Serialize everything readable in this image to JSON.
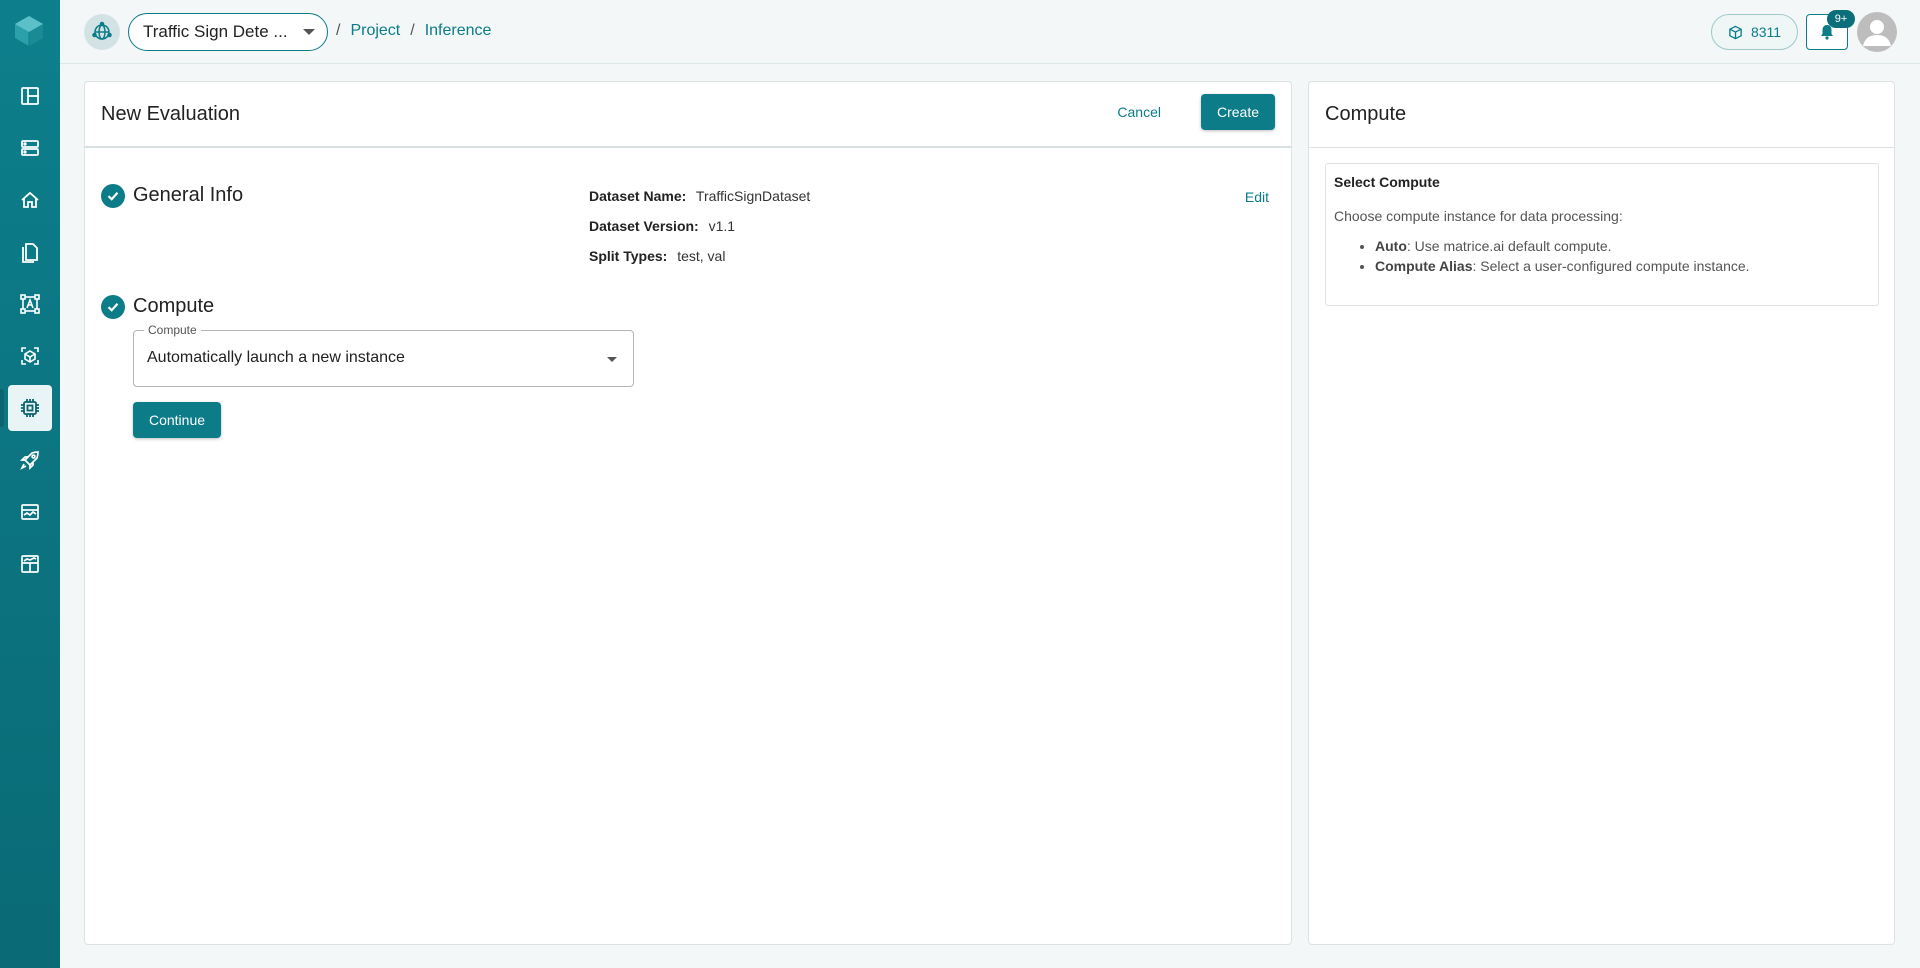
{
  "sidebar": {
    "items": [
      {
        "icon": "layout-icon"
      },
      {
        "icon": "server-icon"
      },
      {
        "icon": "home-icon"
      },
      {
        "icon": "files-icon"
      },
      {
        "icon": "annotation-icon"
      },
      {
        "icon": "model-icon"
      },
      {
        "icon": "chip-icon",
        "active": true
      },
      {
        "icon": "rocket-icon"
      },
      {
        "icon": "monitor-icon"
      },
      {
        "icon": "dashboard-icon"
      }
    ]
  },
  "header": {
    "project_name": "Traffic Sign Dete ...",
    "breadcrumbs": [
      "Project",
      "Inference"
    ],
    "breadcrumb_separator": "/",
    "credits": "8311",
    "notification_badge": "9+"
  },
  "main": {
    "title": "New Evaluation",
    "cancel_label": "Cancel",
    "create_label": "Create",
    "general_info": {
      "title": "General Info",
      "edit_label": "Edit",
      "fields": [
        {
          "label": "Dataset Name:",
          "value": "TrafficSignDataset"
        },
        {
          "label": "Dataset Version:",
          "value": "v1.1"
        },
        {
          "label": "Split Types:",
          "value": "test, val"
        }
      ]
    },
    "compute": {
      "title": "Compute",
      "field_label": "Compute",
      "field_value": "Automatically launch a new instance",
      "continue_label": "Continue"
    }
  },
  "side": {
    "title": "Compute",
    "help_title": "Select Compute",
    "help_desc": "Choose compute instance for data processing:",
    "options": [
      {
        "term": "Auto",
        "desc": ": Use matrice.ai default compute."
      },
      {
        "term": "Compute Alias",
        "desc": ": Select a user-configured compute instance."
      }
    ]
  },
  "colors": {
    "accent": "#0b7c88",
    "sidebar": "#0d7f8c"
  }
}
